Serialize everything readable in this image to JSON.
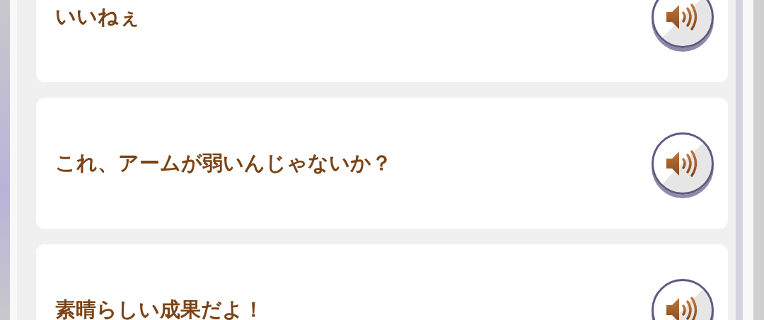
{
  "phrases": [
    {
      "text": "いいねぇ"
    },
    {
      "text": "これ、アームが弱いんじゃないか？"
    },
    {
      "text": "素晴らしい成果だよ！"
    }
  ]
}
